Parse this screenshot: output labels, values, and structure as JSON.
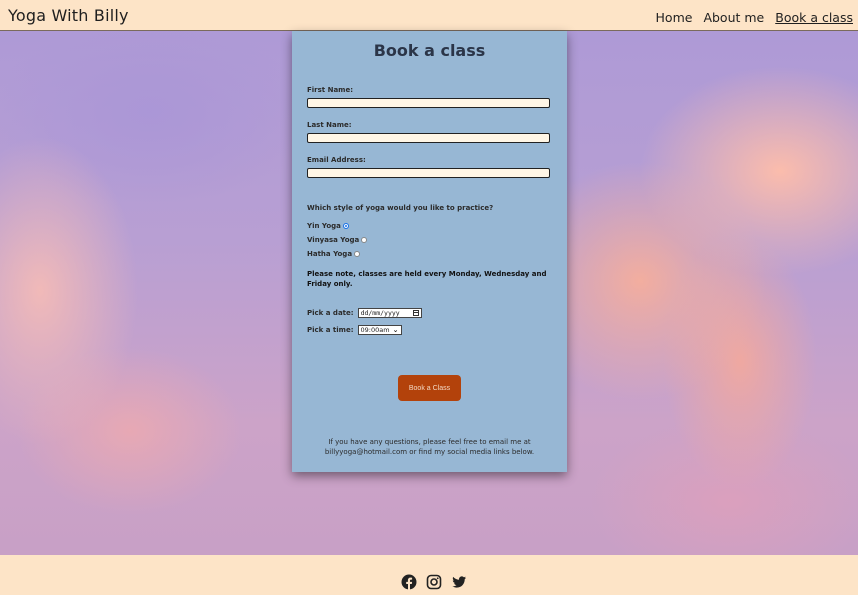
{
  "nav": {
    "brand": "Yoga With Billy",
    "links": [
      {
        "label": "Home"
      },
      {
        "label": "About me"
      },
      {
        "label": "Book a class",
        "active": true
      }
    ]
  },
  "form": {
    "title": "Book a class",
    "first_name_label": "First Name:",
    "last_name_label": "Last Name:",
    "email_label": "Email Address:",
    "style_question": "Which style of yoga would you like to practice?",
    "styles": [
      {
        "label": "Yin Yoga",
        "checked": true
      },
      {
        "label": "Vinyasa Yoga",
        "checked": false
      },
      {
        "label": "Hatha Yoga",
        "checked": false
      }
    ],
    "note": "Please note, classes are held every Monday, Wednesday and Friday only.",
    "date_label": "Pick a date:",
    "date_placeholder": "dd/mm/yyyy",
    "time_label": "Pick a time:",
    "time_value": "09:00am",
    "submit_label": "Book a Class",
    "footnote": "If you have any questions, please feel free to email me at billyyoga@hotmail.com or find my social media links below."
  },
  "footer": {
    "social": [
      "facebook-icon",
      "instagram-icon",
      "twitter-icon"
    ]
  },
  "colors": {
    "nav_bg": "#fde4c7",
    "card_bg": "#97b7d4",
    "button_bg": "#b3420b",
    "title_text": "#2b3548"
  }
}
